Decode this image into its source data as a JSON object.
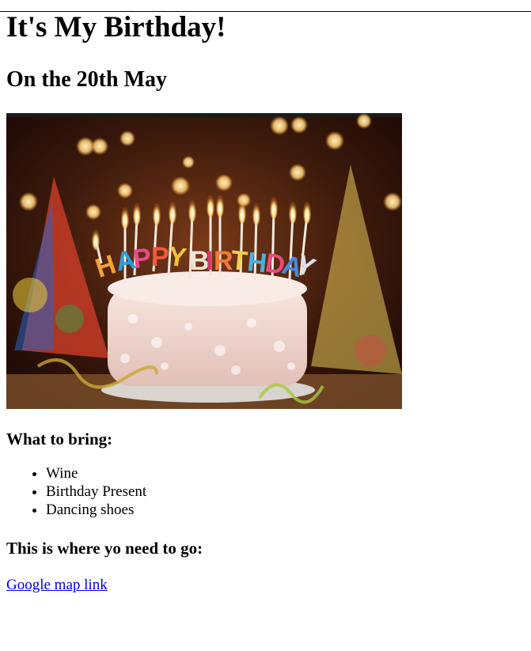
{
  "page": {
    "title": "It's My Birthday!",
    "subtitle": "On the 20th May"
  },
  "image": {
    "candle_letters": [
      "H",
      "A",
      "P",
      "P",
      "Y",
      "B",
      "I",
      "R",
      "T",
      "H",
      "D",
      "A",
      "Y"
    ],
    "colors": {
      "background_dark": "#2a1208",
      "cake_frosting": "#efd3cf",
      "plate": "#d8d4cf",
      "bokeh": "#ffd07a"
    }
  },
  "bring": {
    "heading": "What to bring:",
    "items": [
      "Wine",
      "Birthday Present",
      "Dancing shoes"
    ]
  },
  "location": {
    "heading": "This is where yo need to go:",
    "link_text": "Google map link",
    "link_color": "#0000ee"
  }
}
